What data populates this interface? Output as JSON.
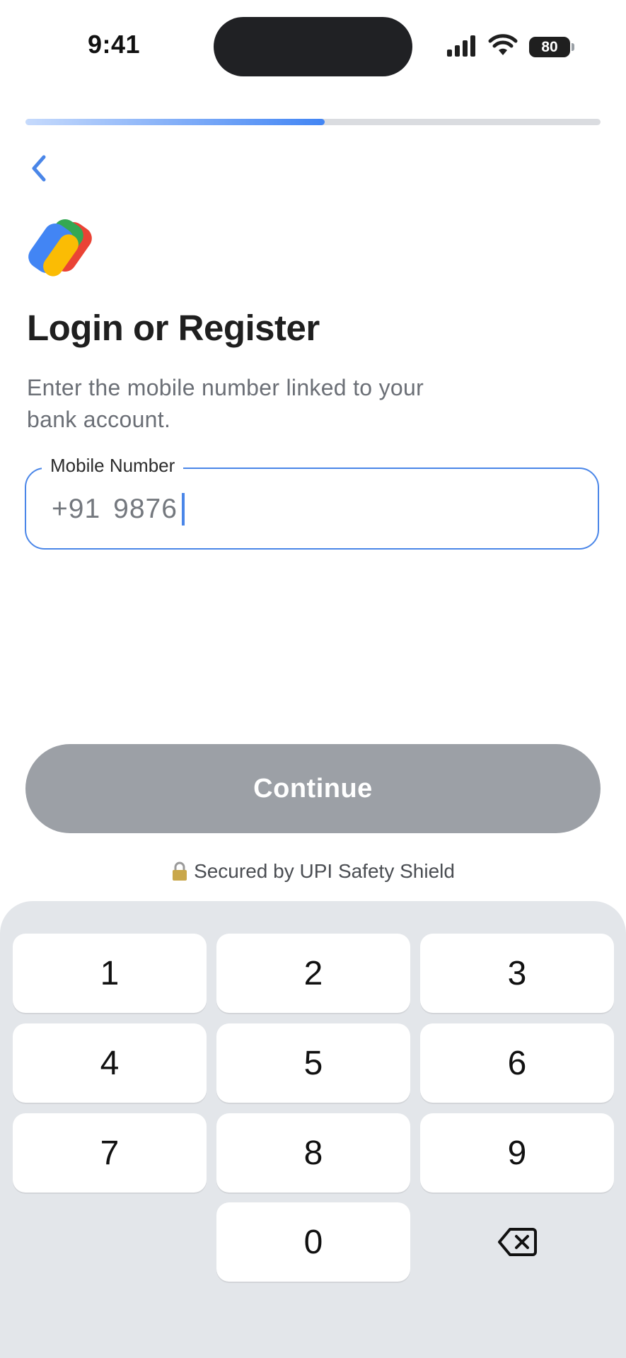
{
  "status_bar": {
    "time": "9:41",
    "battery": "80"
  },
  "progress": {
    "value": 0.52
  },
  "header": {
    "title": "Login or Register",
    "subtitle": "Enter the mobile number linked to your bank account."
  },
  "mobile_field": {
    "label": "Mobile Number",
    "country_code": "+91",
    "value": "9876"
  },
  "continue_label": "Continue",
  "secured_text": "Secured by UPI Safety Shield",
  "keypad": {
    "keys": [
      "1",
      "2",
      "3",
      "4",
      "5",
      "6",
      "7",
      "8",
      "9",
      "0"
    ],
    "backspace_icon": "backspace-icon"
  },
  "colors": {
    "accent": "#4a86e8",
    "button_disabled": "#9ca0a6",
    "keypad_bg": "#e3e6ea"
  }
}
